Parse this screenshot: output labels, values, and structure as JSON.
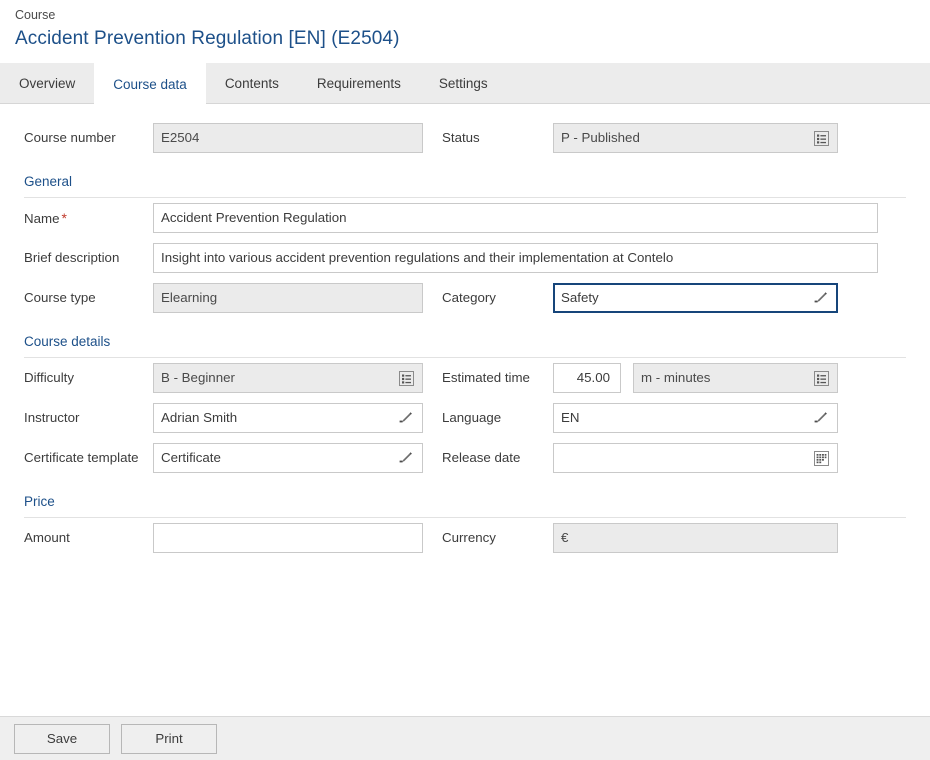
{
  "header": {
    "breadcrumb": "Course",
    "title": "Accident Prevention Regulation [EN] (E2504)"
  },
  "tabs": [
    {
      "label": "Overview",
      "active": false
    },
    {
      "label": "Course data",
      "active": true
    },
    {
      "label": "Contents",
      "active": false
    },
    {
      "label": "Requirements",
      "active": false
    },
    {
      "label": "Settings",
      "active": false
    }
  ],
  "top": {
    "course_number": {
      "label": "Course number",
      "value": "E2504",
      "readonly": true
    },
    "status": {
      "label": "Status",
      "value": "P - Published",
      "readonly": true,
      "icon": "value-help-list-icon"
    }
  },
  "sections": {
    "general": {
      "title": "General",
      "name": {
        "label": "Name",
        "required": "*",
        "value": "Accident Prevention Regulation"
      },
      "brief_description": {
        "label": "Brief description",
        "value": "Insight into various accident prevention regulations and their implementation at Contelo"
      },
      "course_type": {
        "label": "Course type",
        "value": "Elearning",
        "readonly": true
      },
      "category": {
        "label": "Category",
        "value": "Safety",
        "focused": true,
        "icon": "pencil-edit-icon"
      }
    },
    "course_details": {
      "title": "Course details",
      "difficulty": {
        "label": "Difficulty",
        "value": "B - Beginner",
        "readonly": true,
        "icon": "value-help-list-icon"
      },
      "estimated_time": {
        "label": "Estimated time",
        "value": "45.00",
        "unit": "m - minutes",
        "unit_readonly": true,
        "icon": "value-help-list-icon"
      },
      "instructor": {
        "label": "Instructor",
        "value": "Adrian Smith",
        "icon": "pencil-edit-icon"
      },
      "language": {
        "label": "Language",
        "value": "EN",
        "icon": "pencil-edit-icon"
      },
      "certificate_template": {
        "label": "Certificate template",
        "value": "Certificate",
        "icon": "pencil-edit-icon"
      },
      "release_date": {
        "label": "Release date",
        "value": "",
        "placeholder": "",
        "icon": "calendar-icon"
      }
    },
    "price": {
      "title": "Price",
      "amount": {
        "label": "Amount",
        "value": "",
        "placeholder": ""
      },
      "currency": {
        "label": "Currency",
        "value": "€",
        "readonly": true
      }
    }
  },
  "footer": {
    "save": "Save",
    "print": "Print"
  },
  "colors": {
    "accent_blue": "#1d5089",
    "focus_border": "#16457a",
    "required_red": "#c0392b",
    "readonly_bg": "#ebebeb",
    "tabbar_bg": "#ececec",
    "footer_bg": "#efefef"
  }
}
